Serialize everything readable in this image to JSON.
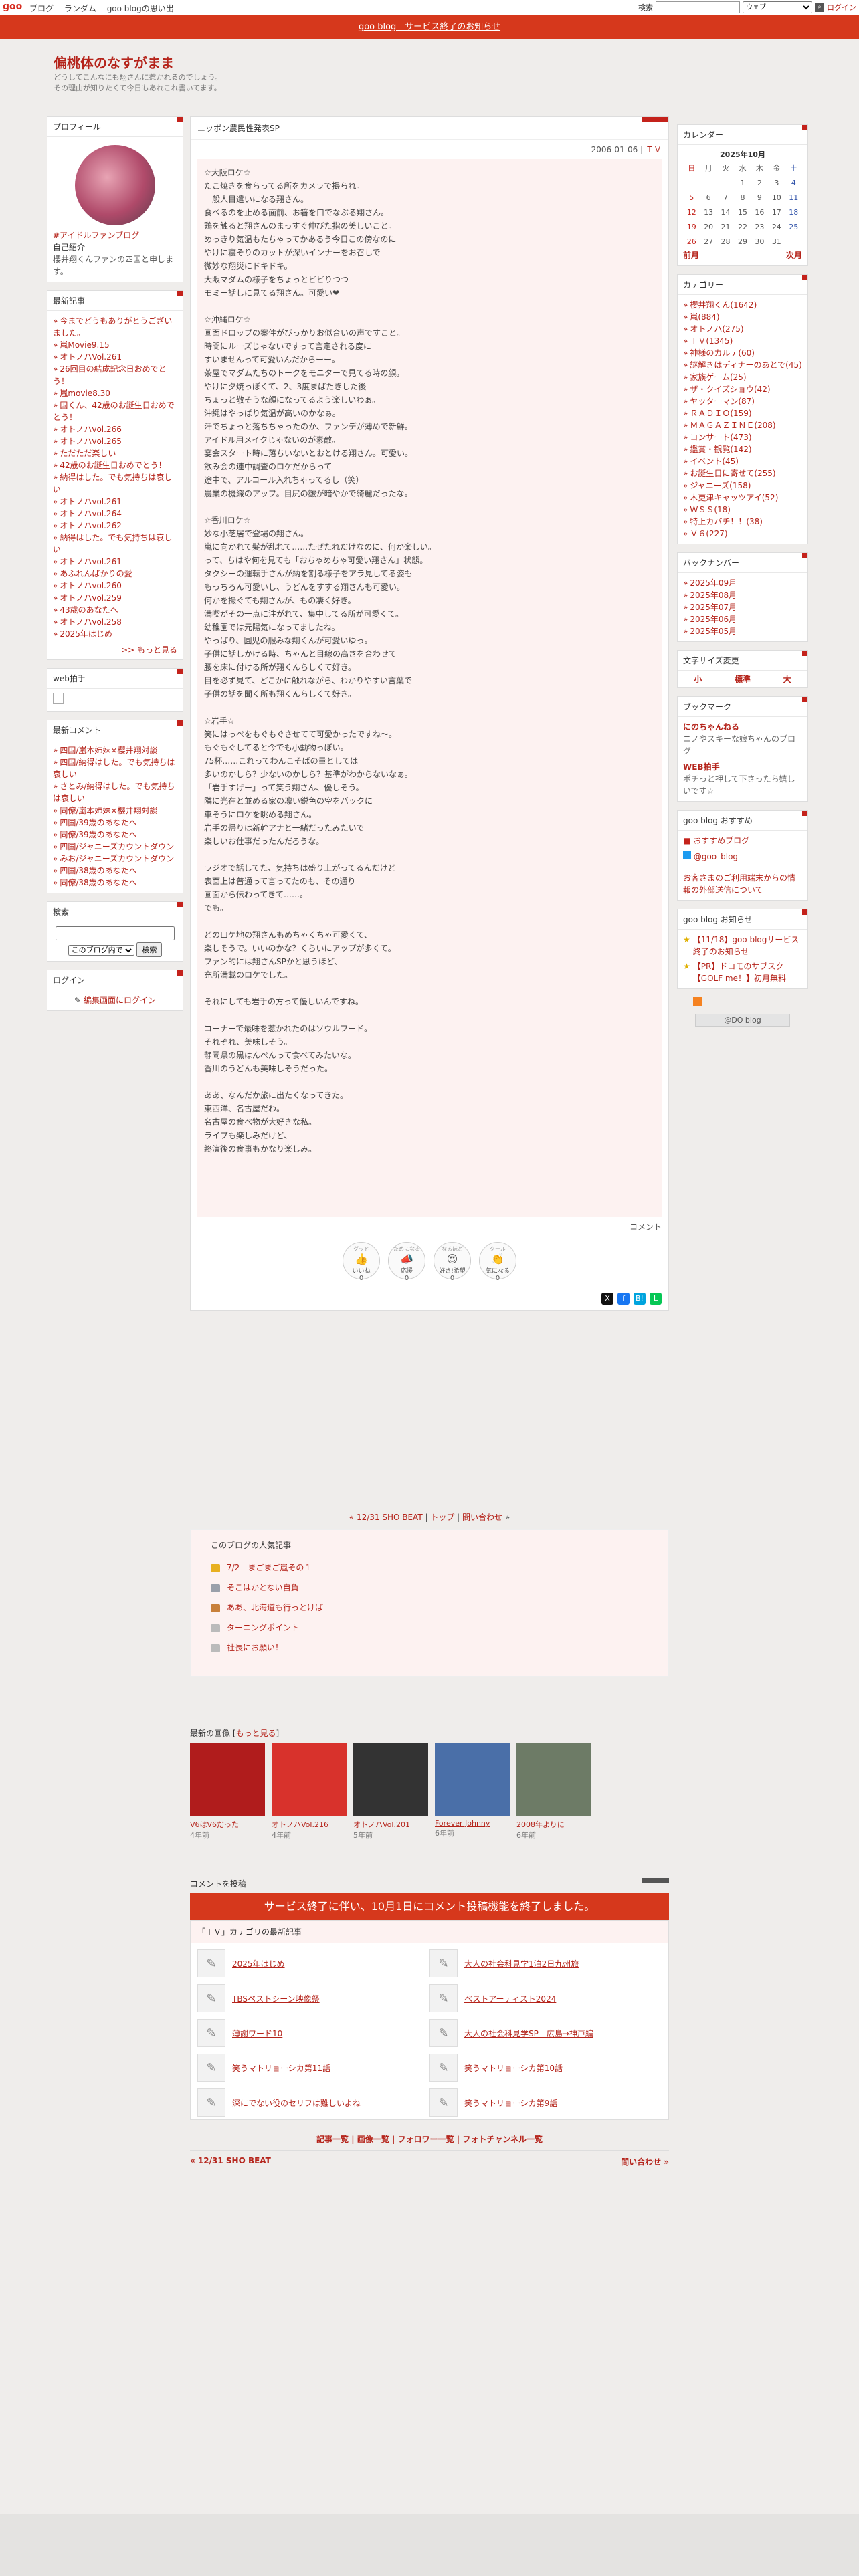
{
  "topbar": {
    "logo": "goo",
    "links": [
      "ブログ",
      "ランダム",
      "goo blogの思い出"
    ],
    "search_label": "検索",
    "search_option": "ウェブ",
    "login": "ログイン"
  },
  "notice": {
    "text": "goo blog　サービス終了のお知らせ"
  },
  "blog": {
    "title": "偏桃体のなすがまま",
    "description_1": "どうしてこんなにも翔さんに惹かれるのでしょう。",
    "description_2": "その理由が知りたくて今日もあれこれ書いてます。"
  },
  "profile": {
    "heading": "プロフィール",
    "tag": "#アイドルファンブログ",
    "intro_label": "自己紹介",
    "intro": "櫻井翔くんファンの四国と申します。"
  },
  "recent": {
    "heading": "最新記事",
    "items": [
      "今までどうもありがとうございました。",
      "嵐Movie9.15",
      "オトノハVol.261",
      "26回目の結成記念日おめでとう！",
      "嵐movie8.30",
      "国くん、42歳のお誕生日おめでとう！",
      "オトノハvol.266",
      "オトノハvol.265",
      "ただただ楽しい",
      "42歳のお誕生日おめでとう！",
      "納得はした。でも気持ちは哀しい",
      "オトノハvol.261",
      "オトノハvol.264",
      "オトノハvol.262",
      "納得はした。でも気持ちは哀しい",
      "オトノハvol.261",
      "あふれんばかりの愛",
      "オトノハvol.260",
      "オトノハvol.259",
      "43歳のあなたへ",
      "オトノハvol.258",
      "2025年はじめ"
    ],
    "more": ">> もっと見る"
  },
  "webclap": {
    "heading": "web拍手"
  },
  "comments": {
    "heading": "最新コメント",
    "items": [
      "四国/嵐本姉妹×櫻井翔対談",
      "四国/納得はした。でも気持ちは哀しい",
      "さとみ/納得はした。でも気持ちは哀しい",
      "同僚/嵐本姉妹×櫻井翔対談",
      "四国/39歳のあなたへ",
      "同僚/39歳のあなたへ",
      "四国/ジャニーズカウントダウン",
      "みお/ジャニーズカウントダウン",
      "四国/38歳のあなたへ",
      "同僚/38歳のあなたへ"
    ]
  },
  "search": {
    "heading": "検索",
    "scope": "このブログ内で",
    "button": "検索"
  },
  "login": {
    "heading": "ログイン",
    "edit": "編集画面にログイン"
  },
  "article": {
    "title": "ニッポン農民性発表SP",
    "date": "2006-01-06",
    "category": "ＴＶ",
    "body": "☆大阪ロケ☆\nたこ焼きを食らってる所をカメラで撮られ。\n一般人目遣いになる翔さん。\n食べるのを止める面前、お箸を口でなぶる翔さん。\n鶏を触ると翔さんのまっすぐ伸びた指の美しいこと。\nめっきり気温もたちゃってかあるう今日この傍なのに\nやけに寝そりのカットが深いインナーをお召しで\n微妙な翔災にドキドキ。\n大阪マダムの様子をちょっとビビりつつ\nモミー話しに見てる翔さん。可愛い❤\n\n☆沖縄ロケ☆\n画面ドロップの案件がびっかりお似合いの声ですこと。\n時間にルーズじゃないですって言定される度に\nすいませんって可愛いんだからーー。\n茶屋でマダムたちのトークをモニターで見てる時の顔。\nやけに夕焼っぽくて、2、3度まばたきした後\nちょっと敬そうな顔になってるよう楽しいわぁ。\n沖縄はやっぱり気温が高いのかなぁ。\n汗でちょっと落ちちゃったのか、ファンデが薄めで新鮮。\nアイドル用メイクじゃないのが素敵。\n宴会スタート時に落ちいないとおとける翔さん。可愛い。\n飲み会の連中調査のロケだからって\n途中で、アルコール入れちゃってるし（笑）\n農業の機織のアップ。目尻の皺が暗やかで綺麗だったな。\n\n☆香川ロケ☆\n妙な小芝居で登場の翔さん。\n嵐に向かれて髪が乱れて……たぜたれだけなのに、何か楽しい。\nって、ちはや何を見ても「おちゃめちゃ可愛い翔さん」状態。\nタクシーの運転手さんが納を割る様子をアラ見してる姿も\nもっちろん可愛いし、うどんをすする翔さんも可愛い。\n何かを撮ぐても翔さんが、もの凄く好き。\n満喫がその一点に注がれて、集中してる所が可愛くて。\n幼稚園では元陽気になってましたね。\nやっぱり、園児の服みな翔くんが可愛いゆっ。\n子供に話しかける時、ちゃんと目線の高さを合わせて\n腰を床に付ける所が翔くんらしくて好き。\n目を必ず見て、どこかに触れながら、わかりやすい言葉で\n子供の話を聞く所も翔くんらしくて好き。\n\n☆岩手☆\n笑にはっぺをもぐもぐさせてて可愛かったですね〜。\nもぐもぐしてると今でも小動物っぽい。\n75杯……これってわんこそばの量としては\n多いのかしら？少ないのかしら？基準がわからないなぁ。\n「岩手すげー」って笑う翔さん、優しそう。\n隣に光在と並める家の凛い鋭色の空をバックに\n車そうにロケを眺める翔さん。\n岩手の帰りは新幹アナと一緒だったみたいで\n楽しいお仕事だったんだろうな。\n\nラジオで話してた、気持ちは盛り上がってるんだけど\n表面上は普通って言ってたのも、その通り\n画面から伝わってきて……。\nでも。\n\nどの口ケ地の翔さんもめちゃくちゃ可愛くて、\n楽しそうで。いいのかな？くらいにアップが多くて。\nファン的には翔さんSPかと思うほど、\n充所満載のロケでした。\n\nそれにしても岩手の方って優しいんですね。\n\nコーナーで最味を惹かれたのはソウルフード。\nそれぞれ、美味しそう。\n静岡県の黒はんぺんって食べてみたいな。\n香川のうどんも美味しそうだった。\n\nああ、なんだか旅に出たくなってきた。\n東西洋、名古屋だわ。\n名古屋の食べ物が大好きな私。\nライブも楽しみだけど、\n終演後の食事もかなり楽しみ。",
    "comment_link": "コメント",
    "reactions": [
      {
        "top": "グッド",
        "label": "いいね",
        "count": "0"
      },
      {
        "top": "ためになる",
        "label": "応援",
        "count": "0"
      },
      {
        "top": "なるほど",
        "label": "好き!希望",
        "count": "0"
      },
      {
        "top": "クール",
        "label": "気になる",
        "count": "0"
      }
    ],
    "share": [
      "X",
      "f",
      "B!",
      "L"
    ]
  },
  "pager": {
    "prev": "« 12/31 SHO BEAT",
    "top": "トップ",
    "contact": "問い合わせ",
    "next": "»"
  },
  "popular": {
    "heading": "このブログの人気記事",
    "items": [
      "7/2　まごまご嵐その１",
      "そこはかとない自負",
      "ああ、北海道も行っとけば",
      "ターニングポイント",
      "社長にお願い！"
    ]
  },
  "images": {
    "heading": "最新の画像",
    "more": "もっと見る",
    "items": [
      {
        "title": "V6はV6だった",
        "age": "4年前",
        "color": "#b01c1c"
      },
      {
        "title": "オトノハVol.216",
        "age": "4年前",
        "color": "#d8322c"
      },
      {
        "title": "オトノハVol.201",
        "age": "5年前",
        "color": "#333333"
      },
      {
        "title": "Forever Johnny",
        "age": "6年前",
        "color": "#4a6fa8"
      },
      {
        "title": "2008年よりに",
        "age": "6年前",
        "color": "#6d7b66"
      }
    ]
  },
  "post_comment": {
    "heading": "コメントを投稿",
    "closed": "サービス終了に伴い、10月1日にコメント投稿機能を終了しました。"
  },
  "cat_latest": {
    "heading": "「ＴＶ」カテゴリの最新記事",
    "items": [
      "2025年はじめ",
      "大人の社会科見学1泊2日九州旅",
      "TBSベストシーン映像祭",
      "ベストアーティスト2024",
      "薄謝ワード10",
      "大人の社会科見学SP　広島→神戸編",
      "笑うマトリョーシカ第11話",
      "笑うマトリョーシカ第10話",
      "深にでない役のセリフは難しいよね",
      "笑うマトリョーシカ第9話"
    ]
  },
  "footer": {
    "links": [
      "記事一覧",
      "画像一覧",
      "フォロワー一覧",
      "フォトチャンネル一覧"
    ],
    "prev": "« 12/31 SHO BEAT",
    "next": "問い合わせ »"
  },
  "calendar": {
    "heading": "カレンダー",
    "month": "2025年10月",
    "days": [
      "日",
      "月",
      "火",
      "水",
      "木",
      "金",
      "土"
    ],
    "rows": [
      [
        "",
        "",
        "",
        "1",
        "2",
        "3",
        "4"
      ],
      [
        "5",
        "6",
        "7",
        "8",
        "9",
        "10",
        "11"
      ],
      [
        "12",
        "13",
        "14",
        "15",
        "16",
        "17",
        "18"
      ],
      [
        "19",
        "20",
        "21",
        "22",
        "23",
        "24",
        "25"
      ],
      [
        "26",
        "27",
        "28",
        "29",
        "30",
        "31",
        ""
      ]
    ],
    "prev": "前月",
    "next": "次月"
  },
  "categories": {
    "heading": "カテゴリー",
    "items": [
      "櫻井翔くん(1642)",
      "嵐(884)",
      "オトノハ(275)",
      "ＴＶ(1345)",
      "神様のカルテ(60)",
      "謎解きはディナーのあとで(45)",
      "家族ゲーム(25)",
      "ザ・クイズショウ(42)",
      "ヤッターマン(87)",
      "ＲＡＤＩＯ(159)",
      "ＭＡＧＡＺＩＮＥ(208)",
      "コンサート(473)",
      "鑑賞・観覧(142)",
      "イベント(45)",
      "お誕生日に寄せて(255)",
      "ジャニーズ(158)",
      "木更津キャッツアイ(52)",
      "ＷＳＳ(18)",
      "特上カバチ！！(38)",
      "Ｖ６(227)"
    ]
  },
  "backnumber": {
    "heading": "バックナンバー",
    "items": [
      "2025年09月",
      "2025年08月",
      "2025年07月",
      "2025年06月",
      "2025年05月"
    ]
  },
  "fontsize": {
    "heading": "文字サイズ変更",
    "small": "小",
    "normal": "標準",
    "large": "大"
  },
  "bookmark": {
    "heading": "ブックマーク",
    "items": [
      {
        "name": "にのちゃんねる",
        "desc": "ニノやスキーな娘ちゃんのブログ"
      },
      {
        "name": "WEB拍手",
        "desc": "ポチっと押して下さったら嬉しいです☆"
      }
    ]
  },
  "goo_recommend": {
    "heading": "goo blog おすすめ",
    "items": [
      "おすすめブログ",
      "@goo_blog"
    ],
    "notice": "お客さまのご利用端末からの情報の外部送信について"
  },
  "goo_news": {
    "heading": "goo blog お知らせ",
    "items": [
      "【11/18】goo blogサービス終了のお知らせ",
      "【PR】ドコモのサブスク【GOLF me！】初月無料"
    ],
    "footer": "@DO blog"
  }
}
